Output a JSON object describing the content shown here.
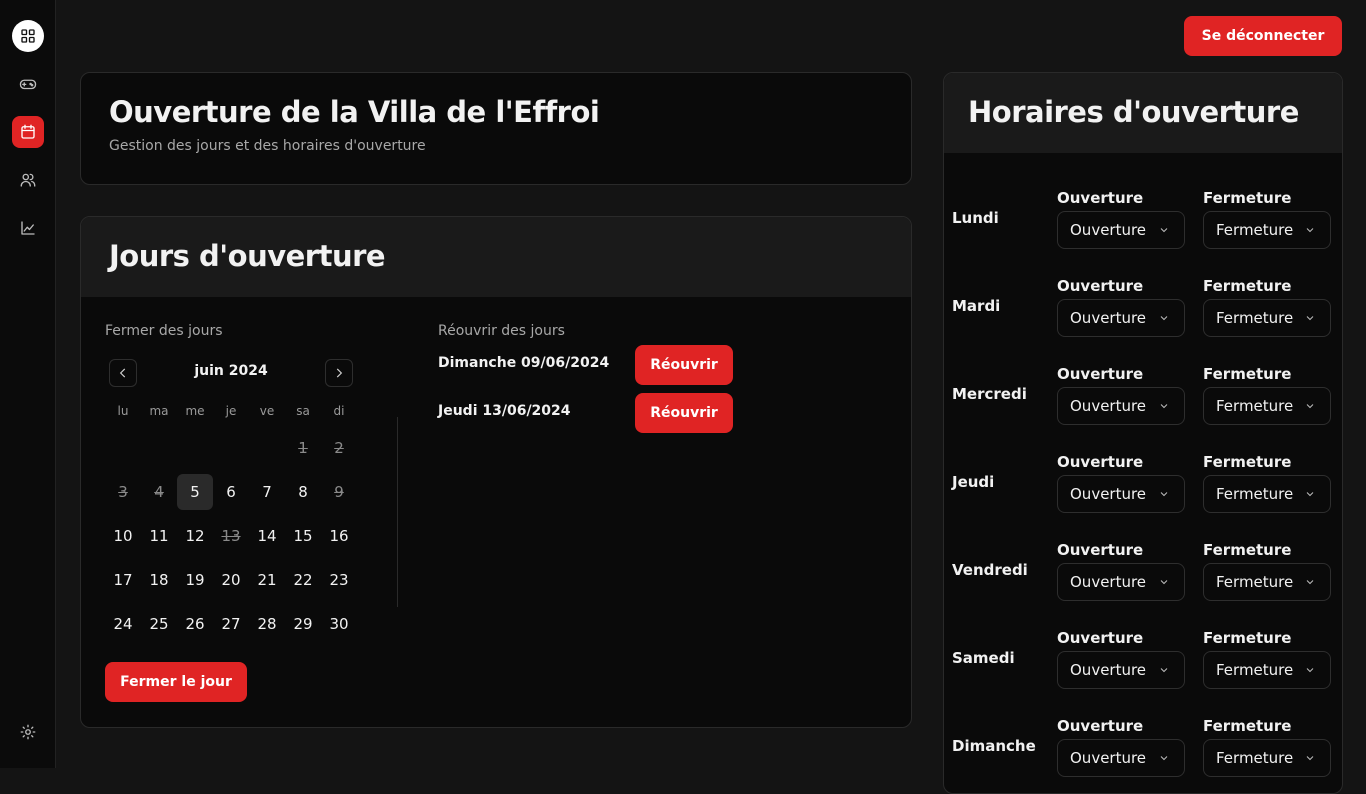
{
  "header": {
    "logout_label": "Se déconnecter"
  },
  "sidebar": {
    "items": [
      {
        "name": "dashboard"
      },
      {
        "name": "games"
      },
      {
        "name": "calendar",
        "active": true
      },
      {
        "name": "users"
      },
      {
        "name": "stats"
      }
    ],
    "settings": "settings"
  },
  "hero": {
    "title": "Ouverture de la Villa de l'Effroi",
    "subtitle": "Gestion des jours et des horaires d'ouverture"
  },
  "days_card": {
    "title": "Jours d'ouverture",
    "close_label": "Fermer des jours",
    "month": "juin 2024",
    "weekdays": [
      "lu",
      "ma",
      "me",
      "je",
      "ve",
      "sa",
      "di"
    ],
    "weeks": [
      [
        "",
        "",
        "",
        "",
        "",
        "1",
        "2"
      ],
      [
        "3",
        "4",
        "5",
        "6",
        "7",
        "8",
        "9"
      ],
      [
        "10",
        "11",
        "12",
        "13",
        "14",
        "15",
        "16"
      ],
      [
        "17",
        "18",
        "19",
        "20",
        "21",
        "22",
        "23"
      ],
      [
        "24",
        "25",
        "26",
        "27",
        "28",
        "29",
        "30"
      ]
    ],
    "closed_days": [
      "1",
      "2",
      "3",
      "4",
      "9",
      "13"
    ],
    "selected_day": "5",
    "close_button": "Fermer le jour",
    "reopen_label": "Réouvrir des jours",
    "reopen_items": [
      {
        "date": "Dimanche 09/06/2024",
        "button": "Réouvrir"
      },
      {
        "date": "Jeudi 13/06/2024",
        "button": "Réouvrir"
      }
    ]
  },
  "hours_card": {
    "title": "Horaires d'ouverture",
    "open_label": "Ouverture",
    "close_label": "Fermeture",
    "open_placeholder": "Ouverture",
    "close_placeholder": "Fermeture",
    "days": [
      "Lundi",
      "Mardi",
      "Mercredi",
      "Jeudi",
      "Vendredi",
      "Samedi",
      "Dimanche"
    ]
  },
  "colors": {
    "accent": "#e02424",
    "background": "#141414",
    "card": "#0a0a0a"
  }
}
